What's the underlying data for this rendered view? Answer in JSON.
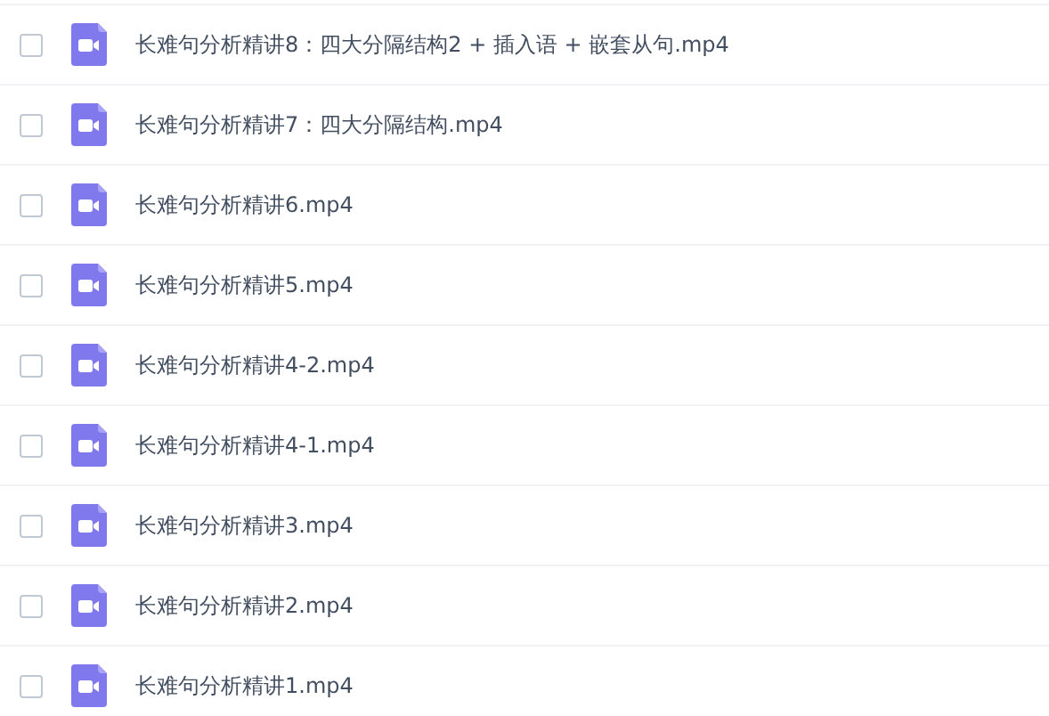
{
  "files": [
    {
      "name": "长难句分析精讲8：四大分隔结构2 + 插入语 + 嵌套从句.mp4",
      "checked": false
    },
    {
      "name": "长难句分析精讲7：四大分隔结构.mp4",
      "checked": false
    },
    {
      "name": "长难句分析精讲6.mp4",
      "checked": false
    },
    {
      "name": "长难句分析精讲5.mp4",
      "checked": false
    },
    {
      "name": "长难句分析精讲4-2.mp4",
      "checked": false
    },
    {
      "name": "长难句分析精讲4-1.mp4",
      "checked": false
    },
    {
      "name": "长难句分析精讲3.mp4",
      "checked": false
    },
    {
      "name": "长难句分析精讲2.mp4",
      "checked": false
    },
    {
      "name": "长难句分析精讲1.mp4",
      "checked": false
    }
  ]
}
